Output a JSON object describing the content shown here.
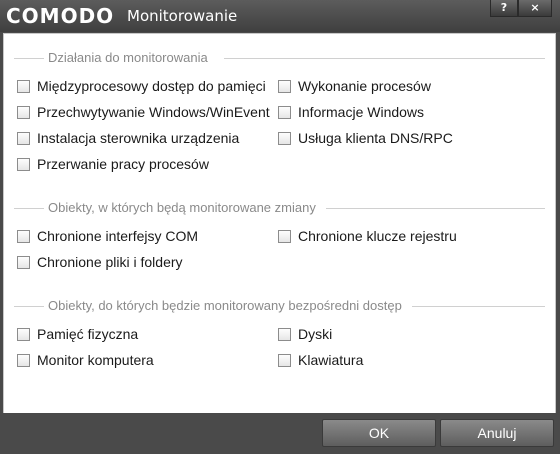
{
  "window": {
    "brand": "COMODO",
    "title": "Monitorowanie",
    "help_label": "?",
    "close_label": "×"
  },
  "sections": [
    {
      "title": "Działania do monitorowania",
      "items": [
        {
          "label": "Międzyprocesowy dostęp do pamięci",
          "checked": false
        },
        {
          "label": "Wykonanie procesów",
          "checked": false
        },
        {
          "label": "Przechwytywanie Windows/WinEvent",
          "checked": false
        },
        {
          "label": "Informacje Windows",
          "checked": false
        },
        {
          "label": "Instalacja sterownika urządzenia",
          "checked": false
        },
        {
          "label": "Usługa klienta DNS/RPC",
          "checked": false
        },
        {
          "label": "Przerwanie pracy procesów",
          "checked": false
        }
      ]
    },
    {
      "title": "Obiekty, w których będą monitorowane zmiany",
      "items": [
        {
          "label": "Chronione interfejsy COM",
          "checked": false
        },
        {
          "label": "Chronione klucze rejestru",
          "checked": false
        },
        {
          "label": "Chronione pliki i foldery",
          "checked": false
        }
      ]
    },
    {
      "title": "Obiekty, do których będzie monitorowany bezpośredni dostęp",
      "items": [
        {
          "label": "Pamięć fizyczna",
          "checked": false
        },
        {
          "label": "Dyski",
          "checked": false
        },
        {
          "label": "Monitor komputera",
          "checked": false
        },
        {
          "label": "Klawiatura",
          "checked": false
        }
      ]
    }
  ],
  "buttons": {
    "ok": "OK",
    "cancel": "Anuluj"
  }
}
